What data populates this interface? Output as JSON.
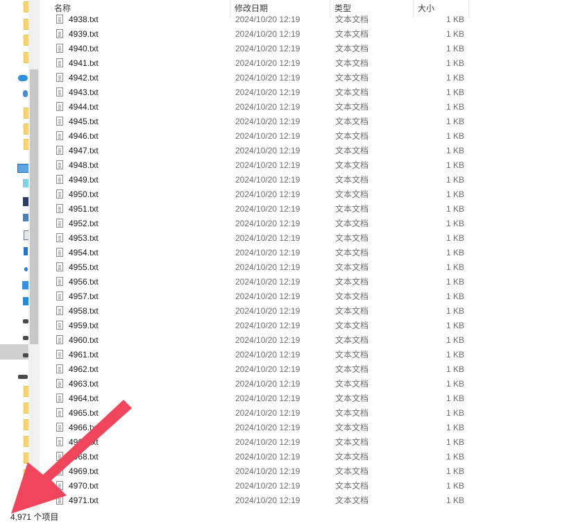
{
  "header": {
    "name": "名称",
    "date": "修改日期",
    "type": "类型",
    "size": "大小"
  },
  "files": [
    {
      "name": "4938.txt",
      "date": "2024/10/20 12:19",
      "type": "文本文档",
      "size": "1 KB"
    },
    {
      "name": "4939.txt",
      "date": "2024/10/20 12:19",
      "type": "文本文档",
      "size": "1 KB"
    },
    {
      "name": "4940.txt",
      "date": "2024/10/20 12:19",
      "type": "文本文档",
      "size": "1 KB"
    },
    {
      "name": "4941.txt",
      "date": "2024/10/20 12:19",
      "type": "文本文档",
      "size": "1 KB"
    },
    {
      "name": "4942.txt",
      "date": "2024/10/20 12:19",
      "type": "文本文档",
      "size": "1 KB"
    },
    {
      "name": "4943.txt",
      "date": "2024/10/20 12:19",
      "type": "文本文档",
      "size": "1 KB"
    },
    {
      "name": "4944.txt",
      "date": "2024/10/20 12:19",
      "type": "文本文档",
      "size": "1 KB"
    },
    {
      "name": "4945.txt",
      "date": "2024/10/20 12:19",
      "type": "文本文档",
      "size": "1 KB"
    },
    {
      "name": "4946.txt",
      "date": "2024/10/20 12:19",
      "type": "文本文档",
      "size": "1 KB"
    },
    {
      "name": "4947.txt",
      "date": "2024/10/20 12:19",
      "type": "文本文档",
      "size": "1 KB"
    },
    {
      "name": "4948.txt",
      "date": "2024/10/20 12:19",
      "type": "文本文档",
      "size": "1 KB"
    },
    {
      "name": "4949.txt",
      "date": "2024/10/20 12:19",
      "type": "文本文档",
      "size": "1 KB"
    },
    {
      "name": "4950.txt",
      "date": "2024/10/20 12:19",
      "type": "文本文档",
      "size": "1 KB"
    },
    {
      "name": "4951.txt",
      "date": "2024/10/20 12:19",
      "type": "文本文档",
      "size": "1 KB"
    },
    {
      "name": "4952.txt",
      "date": "2024/10/20 12:19",
      "type": "文本文档",
      "size": "1 KB"
    },
    {
      "name": "4953.txt",
      "date": "2024/10/20 12:19",
      "type": "文本文档",
      "size": "1 KB"
    },
    {
      "name": "4954.txt",
      "date": "2024/10/20 12:19",
      "type": "文本文档",
      "size": "1 KB"
    },
    {
      "name": "4955.txt",
      "date": "2024/10/20 12:19",
      "type": "文本文档",
      "size": "1 KB"
    },
    {
      "name": "4956.txt",
      "date": "2024/10/20 12:19",
      "type": "文本文档",
      "size": "1 KB"
    },
    {
      "name": "4957.txt",
      "date": "2024/10/20 12:19",
      "type": "文本文档",
      "size": "1 KB"
    },
    {
      "name": "4958.txt",
      "date": "2024/10/20 12:19",
      "type": "文本文档",
      "size": "1 KB"
    },
    {
      "name": "4959.txt",
      "date": "2024/10/20 12:19",
      "type": "文本文档",
      "size": "1 KB"
    },
    {
      "name": "4960.txt",
      "date": "2024/10/20 12:19",
      "type": "文本文档",
      "size": "1 KB"
    },
    {
      "name": "4961.txt",
      "date": "2024/10/20 12:19",
      "type": "文本文档",
      "size": "1 KB"
    },
    {
      "name": "4962.txt",
      "date": "2024/10/20 12:19",
      "type": "文本文档",
      "size": "1 KB"
    },
    {
      "name": "4963.txt",
      "date": "2024/10/20 12:19",
      "type": "文本文档",
      "size": "1 KB"
    },
    {
      "name": "4964.txt",
      "date": "2024/10/20 12:19",
      "type": "文本文档",
      "size": "1 KB"
    },
    {
      "name": "4965.txt",
      "date": "2024/10/20 12:19",
      "type": "文本文档",
      "size": "1 KB"
    },
    {
      "name": "4966.txt",
      "date": "2024/10/20 12:19",
      "type": "文本文档",
      "size": "1 KB"
    },
    {
      "name": "4967.txt",
      "date": "2024/10/20 12:19",
      "type": "文本文档",
      "size": "1 KB"
    },
    {
      "name": "4968.txt",
      "date": "2024/10/20 12:19",
      "type": "文本文档",
      "size": "1 KB"
    },
    {
      "name": "4969.txt",
      "date": "2024/10/20 12:19",
      "type": "文本文档",
      "size": "1 KB"
    },
    {
      "name": "4970.txt",
      "date": "2024/10/20 12:19",
      "type": "文本文档",
      "size": "1 KB"
    },
    {
      "name": "4971.txt",
      "date": "2024/10/20 12:19",
      "type": "文本文档",
      "size": "1 KB"
    }
  ],
  "status": {
    "item_count": "4,971 个项目"
  },
  "annotation": {
    "arrow_color": "#f0455a"
  },
  "nav": {
    "icons": [
      "folder-icon",
      "folder-icon",
      "folder-icon",
      "folder-icon",
      "onedrive-icon",
      "person-icon",
      "folder-icon",
      "folder-icon",
      "folder-icon",
      "folder-icon",
      "this-pc-icon",
      "objects-3d-icon",
      "video-icon",
      "pictures-icon",
      "documents-icon",
      "downloads-icon",
      "music-icon",
      "desktop-icon",
      "windows-drive-icon",
      "drive-icon",
      "drive-icon",
      "drive-icon",
      "network-drive-icon"
    ]
  }
}
